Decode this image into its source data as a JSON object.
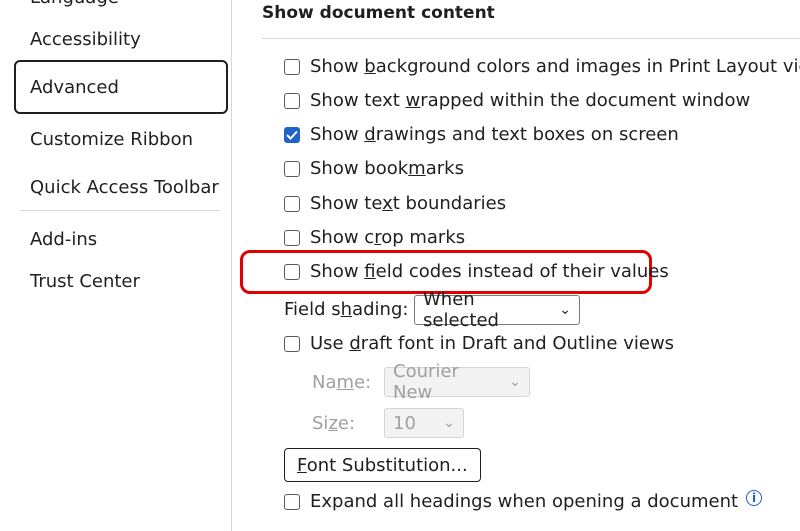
{
  "sidebar": {
    "items": [
      {
        "label": "Language",
        "selected": false
      },
      {
        "label": "Accessibility",
        "selected": false
      },
      {
        "label": "Advanced",
        "selected": true
      },
      {
        "label": "Customize Ribbon",
        "selected": false
      },
      {
        "label": "Quick Access Toolbar",
        "selected": false
      },
      {
        "label": "Add-ins",
        "selected": false
      },
      {
        "label": "Trust Center",
        "selected": false
      }
    ]
  },
  "section": {
    "title": "Show document content"
  },
  "options": [
    {
      "pre": "Show ",
      "key": "b",
      "post": "ackground colors and images in Print Layout view",
      "checked": false
    },
    {
      "pre": "Show text ",
      "key": "w",
      "post": "rapped within the document window",
      "checked": false
    },
    {
      "pre": "Show ",
      "key": "d",
      "post": "rawings and text boxes on screen",
      "checked": true
    },
    {
      "pre": "Show book",
      "key": "m",
      "post": "arks",
      "checked": false
    },
    {
      "pre": "Show te",
      "key": "x",
      "post": "t boundaries",
      "checked": false
    },
    {
      "pre": "Show c",
      "key": "r",
      "post": "op marks",
      "checked": false
    },
    {
      "pre": "Show ",
      "key": "f",
      "post": "ield codes instead of their values",
      "checked": false
    }
  ],
  "field_shading": {
    "pre": "Field s",
    "key": "h",
    "post": "ading:",
    "value": "When selected"
  },
  "draft_font": {
    "pre": "Use ",
    "key": "d",
    "post": "raft font in Draft and Outline views",
    "checked": false
  },
  "name_field": {
    "pre": "Na",
    "key": "m",
    "post": "e:",
    "value": "Courier New"
  },
  "size_field": {
    "pre": "Si",
    "key": "z",
    "post": "e:",
    "value": "10"
  },
  "font_substitution": {
    "pre": "",
    "key": "F",
    "post": "ont Substitution..."
  },
  "expand_headings": {
    "label": "Expand all headings when opening a document",
    "checked": false,
    "info_glyph": "i"
  },
  "colors": {
    "accent": "#1f62c9",
    "highlight": "#e00000"
  },
  "chevron_glyph": "⌄"
}
